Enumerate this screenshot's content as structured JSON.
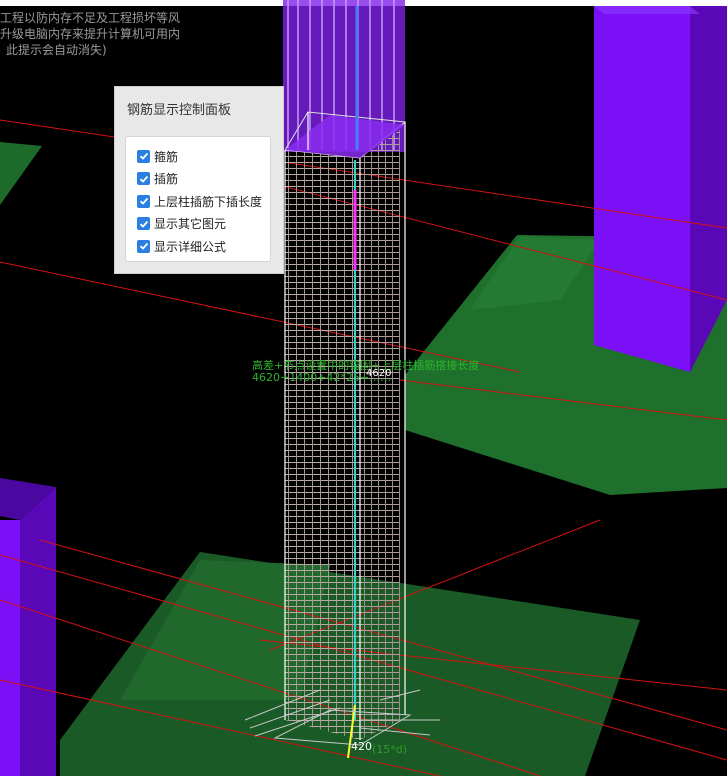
{
  "warning": {
    "lines": [
      "工程以防内存不足及工程损坏等风",
      "升级电脑内存来提升计算机可用内",
      "此提示会自动消失)"
    ]
  },
  "control_panel": {
    "title": "钢筋显示控制面板",
    "options": [
      {
        "label": "箍筋",
        "checked": true
      },
      {
        "label": "插筋",
        "checked": true
      },
      {
        "label": "上层柱插筋下插长度",
        "checked": true
      },
      {
        "label": "显示其它图元",
        "checked": true
      },
      {
        "label": "显示详细公式",
        "checked": true
      }
    ]
  },
  "annotations": {
    "formula_line1": "高差+节点设置中的锚固+上层柱插筋搭接长度",
    "formula_line2": "4620+1400+42*25+……",
    "marker": "4620",
    "bottom_value": "420",
    "bottom_formula": "(15*d)"
  },
  "colors": {
    "column_purple": "#7a10f0",
    "slab_green": "#1f6b2c",
    "gridline_red": "#e01010",
    "rebar_gray": "#b0a0a0",
    "panel_bg": "#e8e8e8",
    "checkbox_blue": "#2a7fe0"
  }
}
